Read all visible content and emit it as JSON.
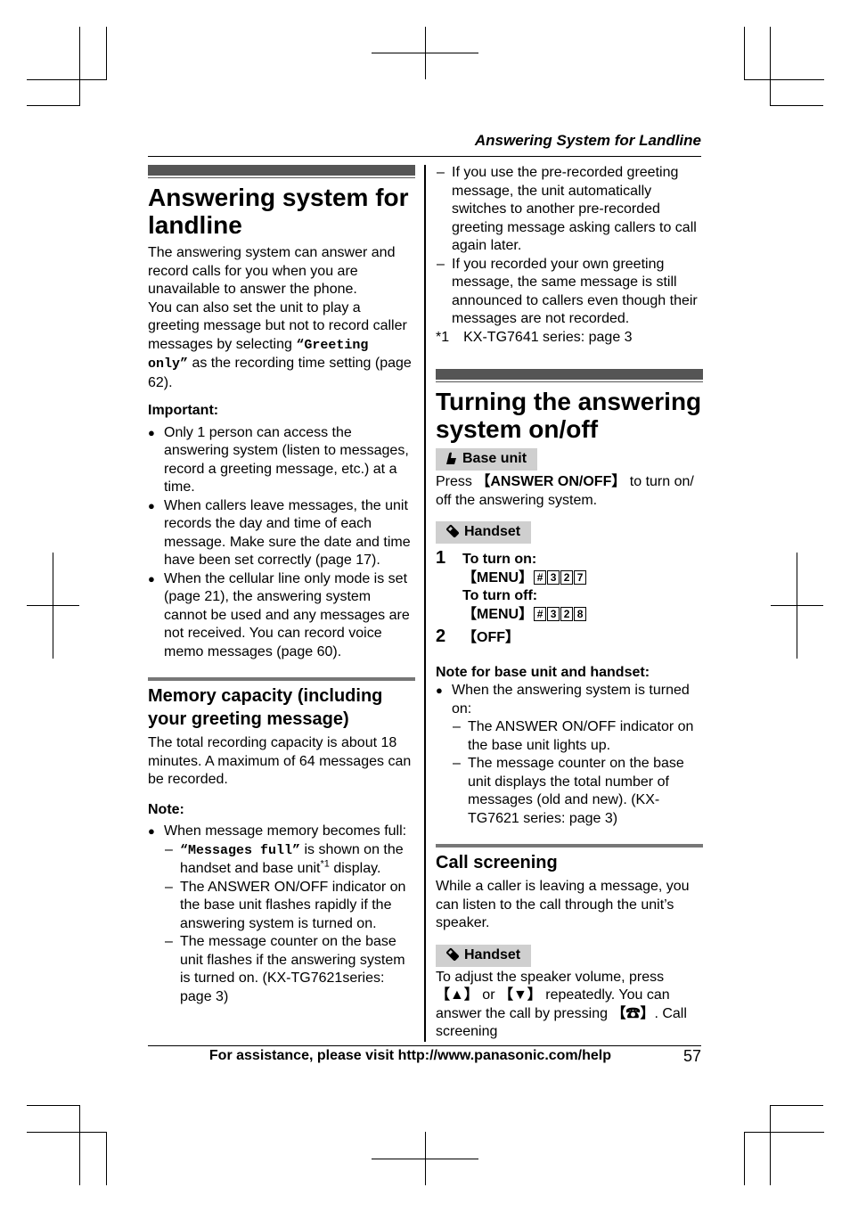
{
  "header": {
    "running_title": "Answering System for Landline"
  },
  "footer": {
    "assistance": "For assistance, please visit http://www.panasonic.com/help",
    "page_number": "57"
  },
  "left": {
    "title": "Answering system for landline",
    "intro_1": "The answering system can answer and record calls for you when you are unavailable to answer the phone.",
    "intro_2_pre": "You can also set the unit to play a greeting message but not to record caller messages by selecting ",
    "intro_2_code": "“Greeting only”",
    "intro_2_post": " as the recording time setting (page 62).",
    "important_label": "Important:",
    "important_items": [
      "Only 1 person can access the answering system (listen to messages, record a greeting message, etc.) at a time.",
      "When callers leave messages, the unit records the day and time of each message. Make sure the date and time have been set correctly (page 17).",
      "When the cellular line only mode is set (page 21), the answering system cannot be used and any messages are not received. You can record voice memo messages (page 60)."
    ],
    "memory_title": "Memory capacity (including your greeting message)",
    "memory_text": "The total recording capacity is about 18 minutes. A maximum of 64 messages can be recorded.",
    "note_label": "Note:",
    "note_bullet": "When message memory becomes full:",
    "note_dash_1_code": "“Messages full”",
    "note_dash_1_text": " is shown on the handset and base unit",
    "note_dash_1_sup": "*1",
    "note_dash_1_end": " display.",
    "note_dash_2": "The ANSWER ON/OFF indicator on the base unit flashes rapidly if the answering system is turned on.",
    "note_dash_3": "The message counter on the base unit flashes if the answering system is turned on. (KX-TG7621series: page 3)"
  },
  "right": {
    "cont_dash_1": "If you use the pre-recorded greeting message, the unit automatically switches to another pre-recorded greeting message asking callers to call again later.",
    "cont_dash_2": "If you recorded your own greeting message, the same message is still announced to callers even though their messages are not recorded.",
    "footnote": "*1 KX-TG7641 series: page 3",
    "title": "Turning the answering system on/off",
    "base_unit_badge": "Base unit",
    "base_press_pre": "Press ",
    "base_press_key": "【ANSWER ON/OFF】",
    "base_press_post": " to turn on/ off the answering system.",
    "handset_badge": "Handset",
    "steps": [
      {
        "num": "1",
        "on_label": "To turn on:",
        "on_menu": "【MENU】",
        "on_keys": [
          "#",
          "3",
          "2",
          "7"
        ],
        "off_label": "To turn off:",
        "off_menu": "【MENU】",
        "off_keys": [
          "#",
          "3",
          "2",
          "8"
        ]
      },
      {
        "num": "2",
        "text": "【OFF】"
      }
    ],
    "note_label": "Note for base unit and handset:",
    "note_bullet": "When the answering system is turned on:",
    "note_dash_1": "The ANSWER ON/OFF indicator on the base unit lights up.",
    "note_dash_2": "The message counter on the base unit displays the total number of messages (old and new). (KX-TG7621 series: page 3)",
    "screening_title": "Call screening",
    "screening_text": "While a caller is leaving a message, you can listen to the call through the unit’s speaker.",
    "screening_badge": "Handset",
    "screening_p_1": "To adjust the speaker volume, press ",
    "screening_key_up": "【▲】",
    "screening_p_2": " or ",
    "screening_key_down": "【▼】",
    "screening_p_3": " repeatedly. You can answer the call by pressing ",
    "screening_key_talk": "【☎】",
    "screening_p_4": ". Call screening"
  }
}
